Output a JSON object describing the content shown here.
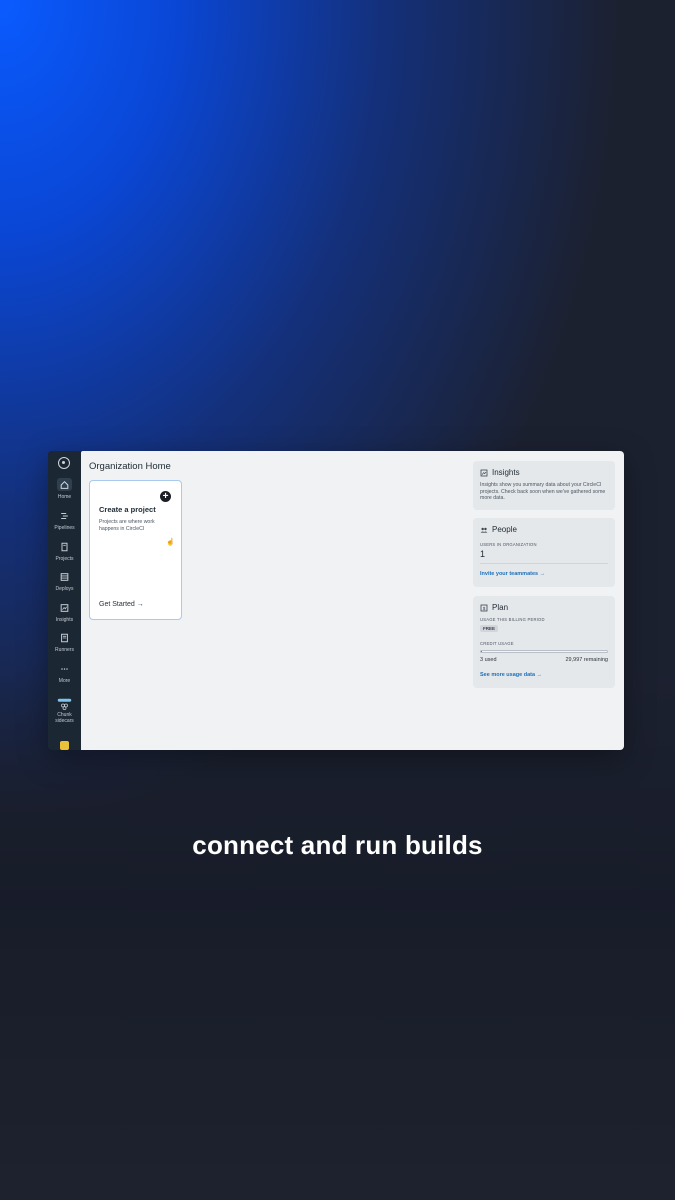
{
  "caption": "connect and run builds",
  "sidebar": {
    "items": [
      {
        "label": "Home",
        "icon": "home-icon"
      },
      {
        "label": "Pipelines",
        "icon": "pipelines-icon"
      },
      {
        "label": "Projects",
        "icon": "projects-icon"
      },
      {
        "label": "Deploys",
        "icon": "deploys-icon"
      },
      {
        "label": "Insights",
        "icon": "insights-icon"
      },
      {
        "label": "Runners",
        "icon": "runners-icon"
      },
      {
        "label": "More",
        "icon": "more-icon"
      },
      {
        "label": "Chunk sidecars",
        "icon": "chunk-icon"
      }
    ]
  },
  "main": {
    "title": "Organization Home",
    "create_card": {
      "title": "Create a project",
      "description": "Projects are where work happens in CircleCI",
      "cta": "Get Started"
    },
    "insights": {
      "title": "Insights",
      "text": "Insights show you summary data about your CircleCI projects. Check back soon when we've gathered some more data."
    },
    "people": {
      "title": "People",
      "users_label": "USERS IN ORGANIZATION",
      "users_count": "1",
      "invite_link": "Invite your teammates →"
    },
    "plan": {
      "title": "Plan",
      "period_label": "USAGE THIS BILLING PERIOD",
      "badge": "FREE",
      "credit_label": "CREDIT USAGE",
      "used": "3 used",
      "remaining": "29,997 remaining",
      "usage_fraction": 0.0001,
      "usage_link": "See more usage data →"
    }
  },
  "colors": {
    "accent_link": "#1e6fb8",
    "sidebar_bg": "#1b2733",
    "card_border": "#a9c9ee"
  }
}
